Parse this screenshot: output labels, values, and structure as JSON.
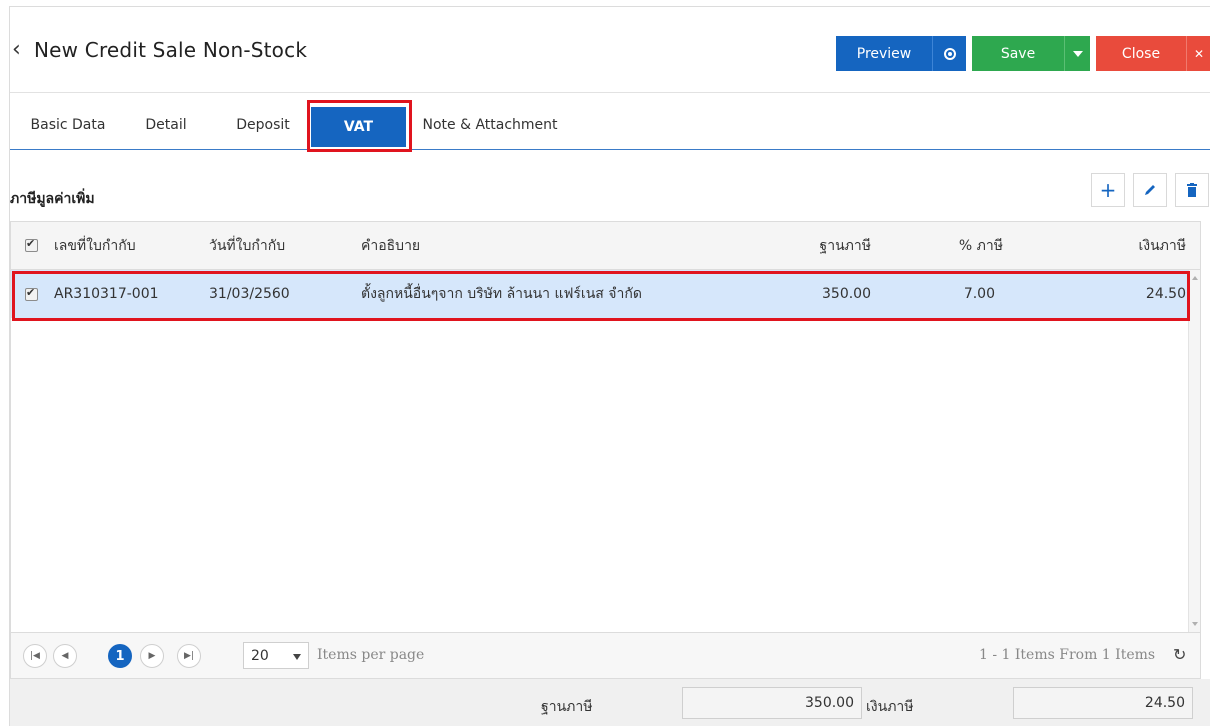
{
  "header": {
    "title": "New Credit Sale Non-Stock",
    "back_icon": "chevron-left-icon",
    "buttons": {
      "preview": "Preview",
      "save": "Save",
      "close": "Close"
    },
    "colors": {
      "preview": "#1565c0",
      "save": "#2ea84f",
      "close": "#e94b3c"
    }
  },
  "tabs": [
    {
      "label": "Basic Data"
    },
    {
      "label": "Detail"
    },
    {
      "label": "Deposit"
    },
    {
      "label": "VAT",
      "active": true
    },
    {
      "label": "Note & Attachment"
    }
  ],
  "section": {
    "title": "ภาษีมูลค่าเพิ่ม"
  },
  "grid": {
    "columns": [
      "เลขที่ใบกำกับ",
      "วันที่ใบกำกับ",
      "คำอธิบาย",
      "ฐานภาษี",
      "% ภาษี",
      "เงินภาษี"
    ],
    "rows": [
      {
        "checked": true,
        "invoice_no": "AR310317-001",
        "invoice_date": "31/03/2560",
        "description": "ตั้งลูกหนี้อื่นๆจาก บริษัท ล้านนา แฟร์เนส จำกัด",
        "tax_base": "350.00",
        "tax_pct": "7.00",
        "tax_amount": "24.50"
      }
    ]
  },
  "pager": {
    "current_page": "1",
    "page_size": "20",
    "items_per_page_label": "Items per page",
    "info": "1 - 1 Items From 1 Items"
  },
  "totals": {
    "tax_base_label": "ฐานภาษี",
    "tax_base_value": "350.00",
    "tax_amount_label": "เงินภาษี",
    "tax_amount_value": "24.50"
  }
}
